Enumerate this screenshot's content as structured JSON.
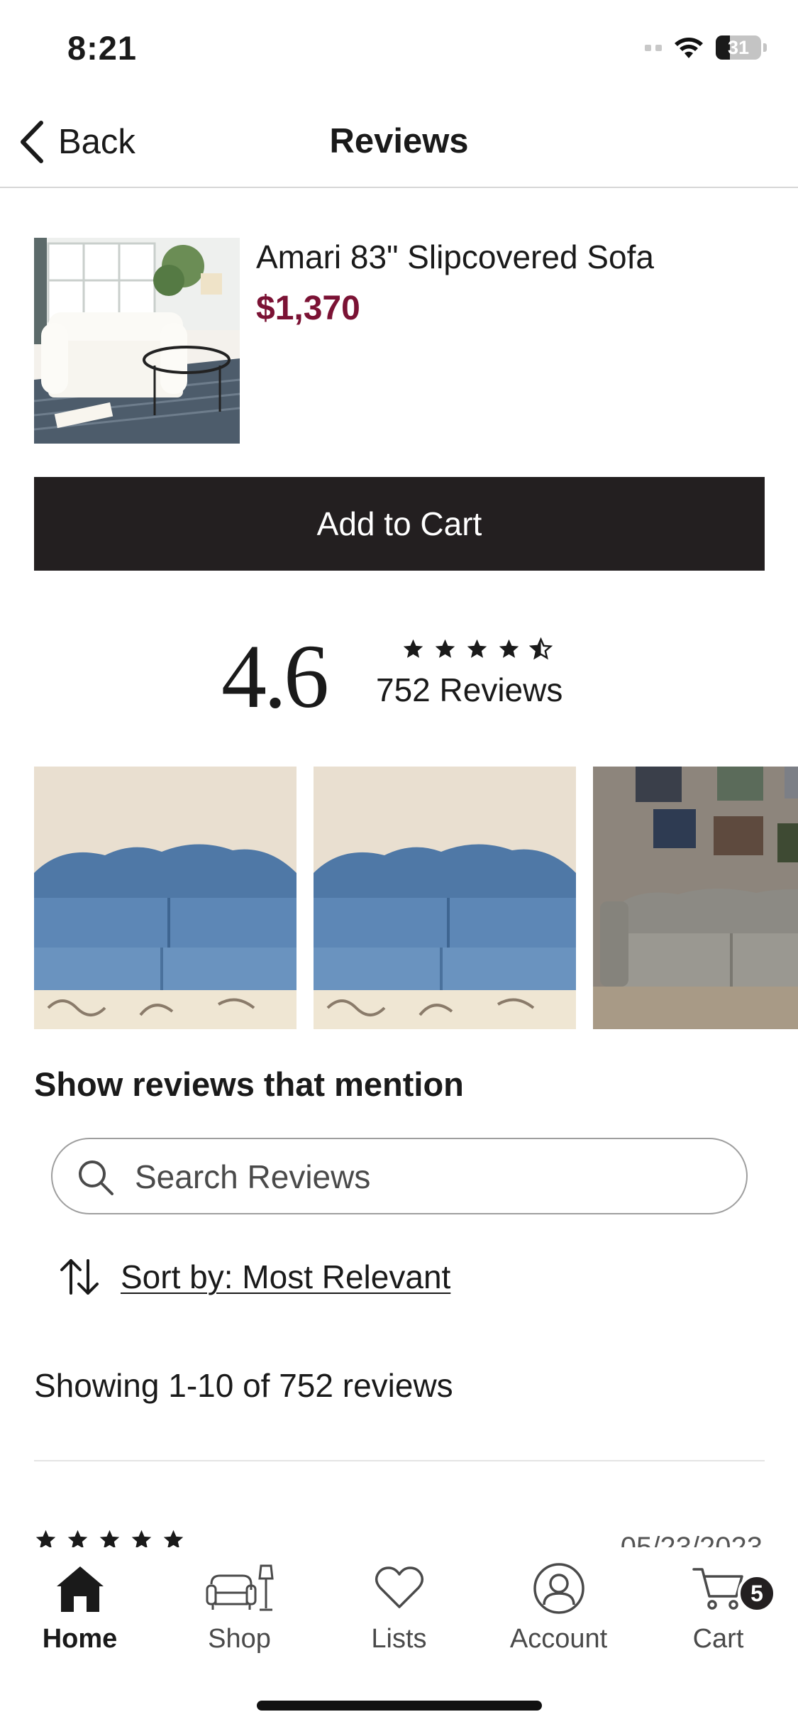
{
  "status_bar": {
    "time": "8:21",
    "battery": "31",
    "battery_level": 0.31
  },
  "nav": {
    "back_label": "Back",
    "title": "Reviews"
  },
  "product": {
    "name": "Amari 83\" Slipcovered Sofa",
    "price": "$1,370",
    "price_color": "#7b1234"
  },
  "add_to_cart_label": "Add to Cart",
  "rating": {
    "average": "4.6",
    "stars": 4.5,
    "count_label": "752 Reviews"
  },
  "photos": [
    {
      "name": "review-photo-blue-sofa-1"
    },
    {
      "name": "review-photo-blue-sofa-2"
    },
    {
      "name": "review-photo-gray-sofa"
    }
  ],
  "mention_heading": "Show reviews that mention",
  "search": {
    "placeholder": "Search Reviews",
    "value": ""
  },
  "sort": {
    "label": "Sort by: Most Relevant"
  },
  "showing_text": "Showing 1-10 of 752 reviews",
  "first_review": {
    "stars": 5,
    "date": "05/23/2023"
  },
  "tabs": [
    {
      "label": "Home",
      "icon": "house-icon",
      "active": true
    },
    {
      "label": "Shop",
      "icon": "sofa-lamp-icon",
      "active": false
    },
    {
      "label": "Lists",
      "icon": "heart-icon",
      "active": false
    },
    {
      "label": "Account",
      "icon": "person-icon",
      "active": false
    },
    {
      "label": "Cart",
      "icon": "cart-icon",
      "active": false,
      "badge": "5"
    }
  ]
}
